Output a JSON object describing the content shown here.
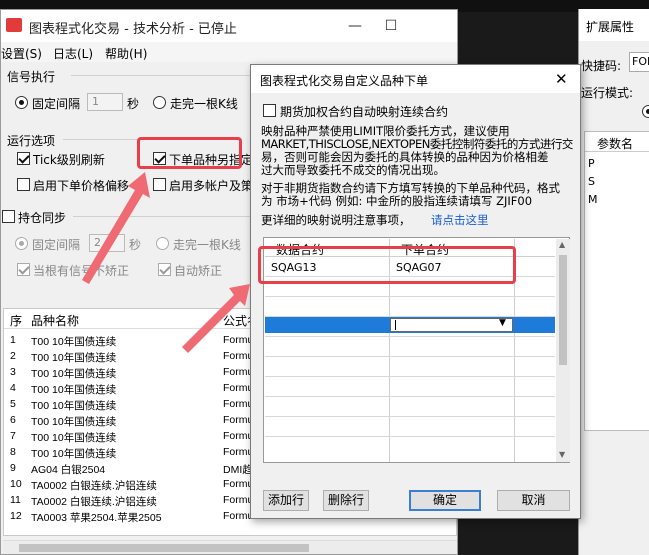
{
  "main_window": {
    "title": "图表程式化交易 - 技术分析 - 已停止",
    "controls": {
      "minimize": "—",
      "maximize": "☐",
      "close": "✕"
    },
    "menu": [
      "设置(S)",
      "日志(L)",
      "帮助(H)"
    ],
    "signal": {
      "section": "信号执行",
      "fixed_interval": "固定间隔",
      "interval_value": "1",
      "unit": "秒",
      "each_kline": "走完一根K线"
    },
    "run_options": {
      "section": "运行选项",
      "tick_refresh": "Tick级别刷新",
      "order_other": "下单品种另指定",
      "price_offset": "启用下单价格偏移",
      "multi_account": "启用多帐户及策"
    },
    "position_sync": {
      "section": "持仓同步",
      "fixed_interval": "固定间隔",
      "interval_value": "2",
      "unit": "秒",
      "each_kline": "走完一根K线",
      "no_correct": "当根有信号不矫正",
      "auto_correct": "自动矫正"
    },
    "list": {
      "headers": [
        "序",
        "品种名称",
        "公式名"
      ],
      "rows": [
        [
          "1",
          "T00 10年国债连续",
          "Formu"
        ],
        [
          "2",
          "T00 10年国债连续",
          "Formu"
        ],
        [
          "3",
          "T00 10年国债连续",
          "Formu"
        ],
        [
          "4",
          "T00 10年国债连续",
          "Formu"
        ],
        [
          "5",
          "T00 10年国债连续",
          "Formu"
        ],
        [
          "6",
          "T00 10年国债连续",
          "Formu"
        ],
        [
          "7",
          "T00 10年国债连续",
          "Formu"
        ],
        [
          "8",
          "T00 10年国债连续",
          "Formu"
        ],
        [
          "9",
          "AG04 白银2504",
          "DMI趋"
        ],
        [
          "10",
          "TA0002 白银连续.沪铝连续",
          "Formu"
        ],
        [
          "11",
          "TA0002 白银连续.沪铝连续",
          "Formu"
        ],
        [
          "12",
          "TA0003 苹果2504.苹果2505",
          "Formu"
        ]
      ]
    }
  },
  "right_panel": {
    "title": "扩展属性",
    "code_label": "快捷码:",
    "code_value": "FOR",
    "run_mode_label": "运行模式:",
    "param_header": "参数名",
    "params": [
      "P",
      "S",
      "M"
    ]
  },
  "dialog": {
    "title": "图表程式化交易自定义品种下单",
    "close": "✕",
    "futures_option": "期货加权合约自动映射连续合约",
    "desc_lines": [
      "映射品种严禁使用LIMIT限价委托方式，建议使用",
      "MARKET,THISCLOSE,NEXTOPEN委托控制符委托的方式进行交",
      "易，否则可能会因为委托的具体转换的品种因为价格相差",
      "过大而导致委托不成交的情况出现。"
    ],
    "non_index_lines": [
      "对于非期货指数合约请下方填写转换的下单品种代码，格式",
      "为 市场+代码 例如: 中金所的股指连续请填写 ZJIF00"
    ],
    "detail_text": "更详细的映射说明注意事项，",
    "detail_link": "请点击这里",
    "grid": {
      "col_data": "数据合约",
      "col_order": "下单合约",
      "rows": [
        {
          "data": "SQAG13",
          "order": "SQAG07"
        }
      ]
    },
    "buttons": {
      "add": "添加行",
      "delete": "删除行",
      "ok": "确定",
      "cancel": "取消"
    }
  },
  "colors": {
    "annotation_red": "#e8404b",
    "selection_blue": "#1e7bd8",
    "link_blue": "#1a5fd0"
  }
}
